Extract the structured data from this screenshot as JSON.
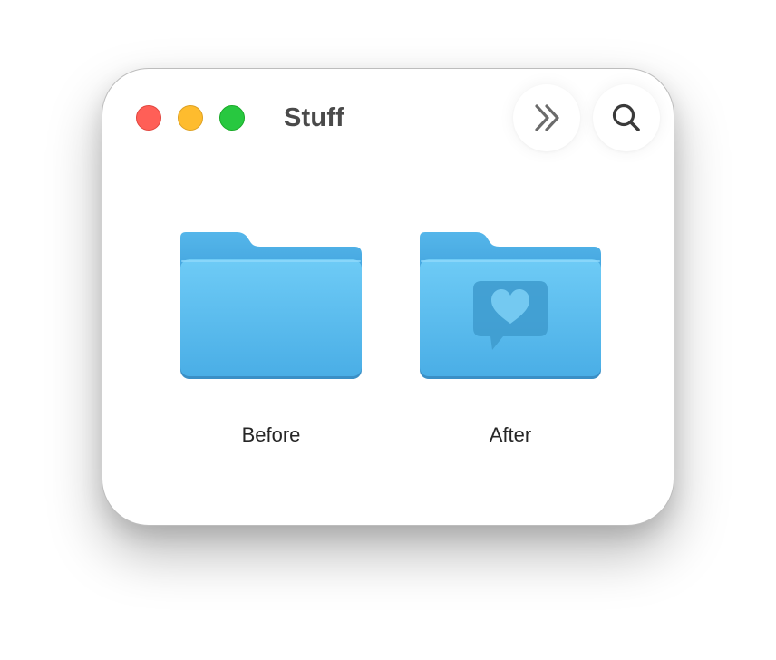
{
  "window": {
    "title": "Stuff",
    "traffic_lights": {
      "close_color": "#ff5f57",
      "minimize_color": "#febc2e",
      "zoom_color": "#28c840"
    }
  },
  "toolbar": {
    "more_icon": "chevron-double-right-icon",
    "search_icon": "search-icon"
  },
  "folders": [
    {
      "label": "Before",
      "icon": "folder-icon"
    },
    {
      "label": "After",
      "icon": "folder-heart-speech-icon"
    }
  ],
  "colors": {
    "folder_blue": "#5ab8ec",
    "folder_tab_blue": "#4aa9e2"
  }
}
